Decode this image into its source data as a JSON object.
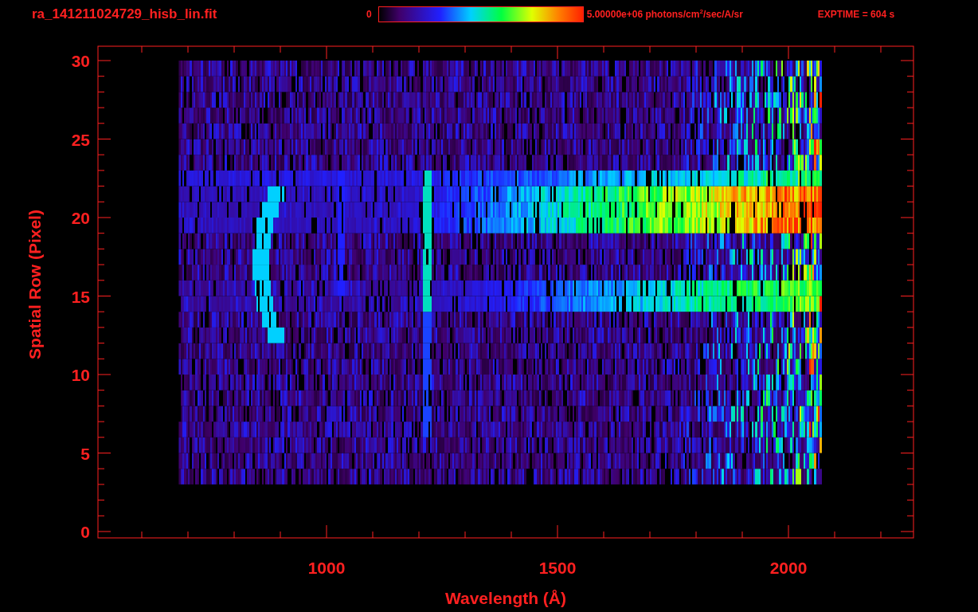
{
  "header": {
    "title": "ra_141211024729_hisb_lin.fit",
    "colorbar_min": "0",
    "colorbar_max": "5.00000e+06 photons/cm$^{2}$/sec/A/sr",
    "exptime": "EXPTIME = 604 s"
  },
  "plot": {
    "xlabel": "Wavelength (Å)",
    "ylabel": "Spatial Row (Pixel)",
    "xticks": [
      "1000",
      "1500",
      "2000"
    ],
    "yticks": [
      "30",
      "25",
      "20",
      "15",
      "10",
      "5",
      "0"
    ]
  }
}
